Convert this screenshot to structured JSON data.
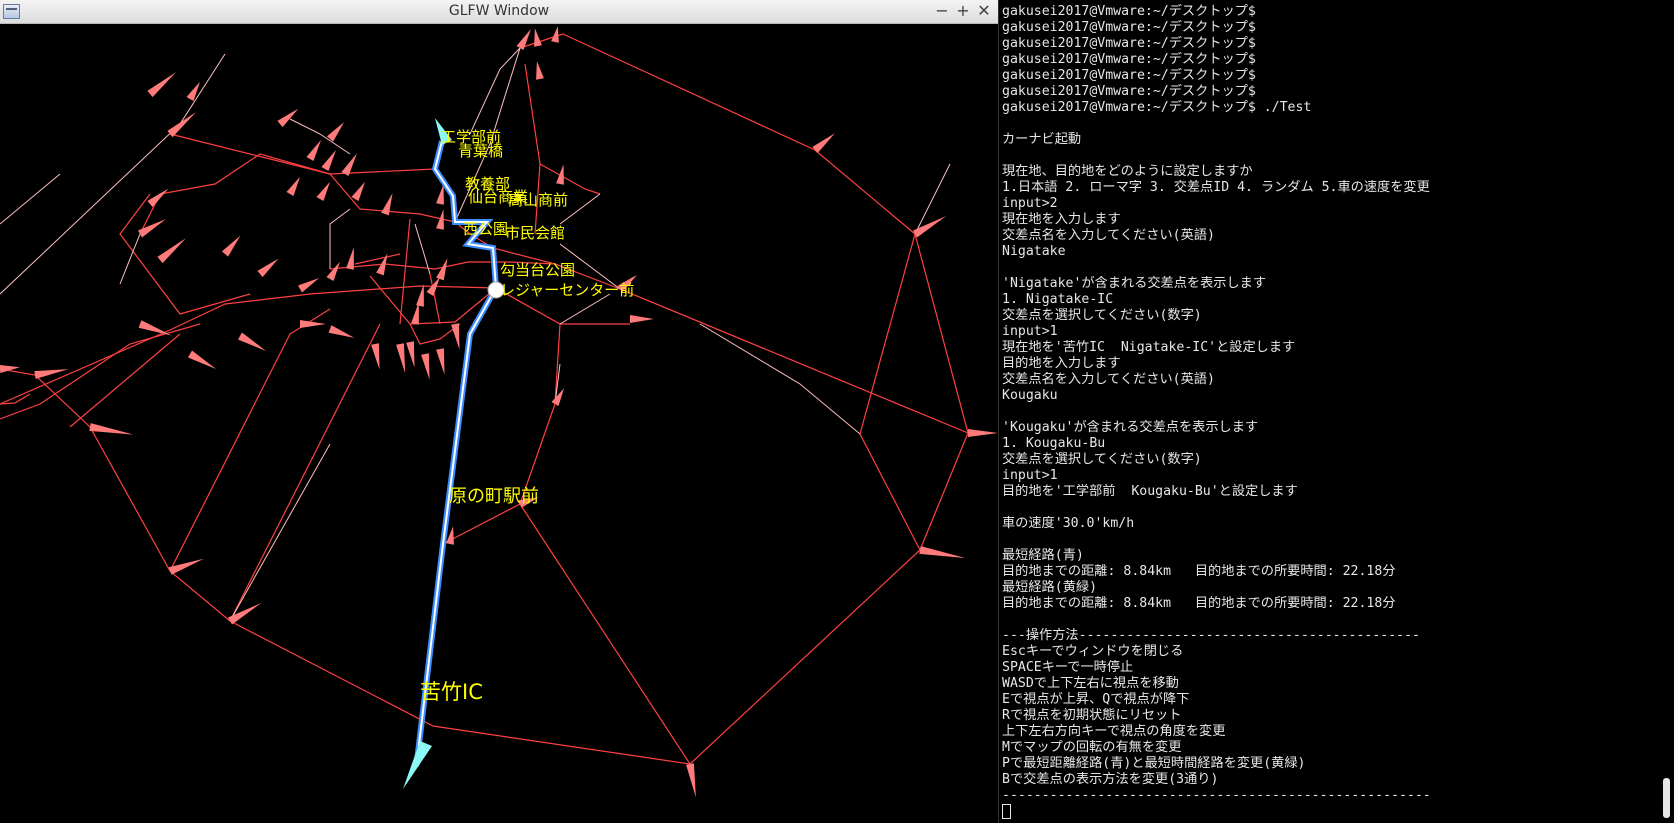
{
  "glfw_window": {
    "title": "GLFW Window",
    "controls": {
      "minimize": "−",
      "maximize": "+",
      "close": "✕"
    },
    "menu_icon": "window-menu-icon"
  },
  "map": {
    "colors": {
      "roads": "#ff4040",
      "secondary_roads": "#ffc0c0",
      "route_blue": "#3a8cff",
      "route_white": "#ffffff",
      "route_cyan": "#8cf8f8",
      "labels": "#ffff00"
    },
    "labels": {
      "kougakubumae": "工学部前",
      "aobabashi": "青葉橋",
      "kyouyoubu": "教養部",
      "sendaisho": "仙台商業",
      "hatakenakamae": "高山商前",
      "nishikouen": "西公園",
      "shiminkaikan": "市民会館",
      "koutoudaikouen": "勾当台公園",
      "leisurecenter": "レジャーセンター前",
      "haranomachi": "原の町駅前",
      "nigatake": "苦竹IC"
    }
  },
  "terminal": {
    "lines": [
      "gakusei2017@Vmware:~/デスクトップ$",
      "gakusei2017@Vmware:~/デスクトップ$",
      "gakusei2017@Vmware:~/デスクトップ$",
      "gakusei2017@Vmware:~/デスクトップ$",
      "gakusei2017@Vmware:~/デスクトップ$",
      "gakusei2017@Vmware:~/デスクトップ$",
      "gakusei2017@Vmware:~/デスクトップ$ ./Test",
      "",
      "カーナビ起動",
      "",
      "現在地、目的地をどのように設定しますか",
      "1.日本語 2. ローマ字 3. 交差点ID 4. ランダム 5.車の速度を変更",
      "input>2",
      "現在地を入力します",
      "交差点名を入力してください(英語)",
      "Nigatake",
      "",
      "'Nigatake'が含まれる交差点を表示します",
      "1. Nigatake-IC",
      "交差点を選択してください(数字)",
      "input>1",
      "現在地を'苦竹IC  Nigatake-IC'と設定します",
      "目的地を入力します",
      "交差点名を入力してください(英語)",
      "Kougaku",
      "",
      "'Kougaku'が含まれる交差点を表示します",
      "1. Kougaku-Bu",
      "交差点を選択してください(数字)",
      "input>1",
      "目的地を'工学部前  Kougaku-Bu'と設定します",
      "",
      "車の速度'30.0'km/h",
      "",
      "最短経路(青)",
      "目的地までの距離: 8.84km   目的地までの所要時間: 22.18分",
      "最短経路(黄緑)",
      "目的地までの距離: 8.84km   目的地までの所要時間: 22.18分",
      "",
      "---操作方法-------------------------------------------",
      "Escキーでウィンドウを閉じる",
      "SPACEキーで一時停止",
      "WASDで上下左右に視点を移動",
      "Eで視点が上昇、Qで視点が降下",
      "Rで視点を初期状態にリセット",
      "上下左右方向キーで視点の角度を変更",
      "Mでマップの回転の有無を変更",
      "Pで最短距離経路(青)と最短時間経路を変更(黄緑)",
      "Bで交差点の表示方法を変更(3通り)",
      "------------------------------------------------------"
    ]
  }
}
